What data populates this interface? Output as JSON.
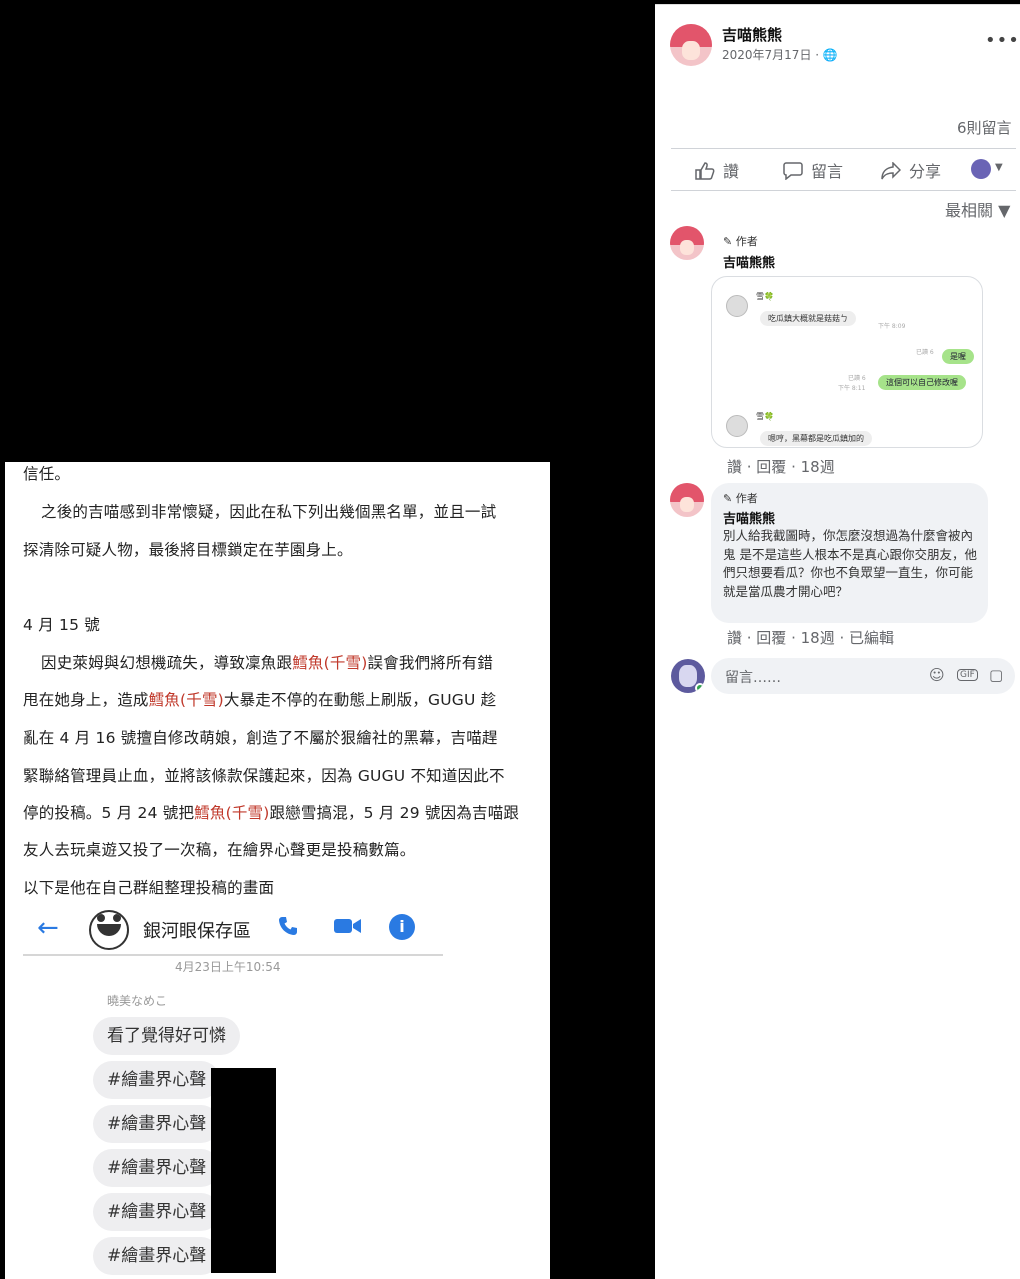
{
  "document": {
    "lines": [
      "信任。",
      "之後的吉喵感到非常懷疑，因此在私下列出幾個黑名單，並且一試",
      "探清除可疑人物，最後將目標鎖定在芋園身上。",
      "4 月 15 號",
      "因史萊姆與幻想機疏失，導致凜魚跟",
      "鱈魚(千雪)",
      "誤會我們將所有錯",
      "甩在她身上，造成",
      "鱈魚(千雪)",
      "大暴走不停的在動態上刷版，GUGU 趁",
      "亂在 4 月 16 號擅自修改萌娘，創造了不屬於狠繪社的黑幕，吉喵趕",
      "緊聯絡管理員止血，並將該條款保護起來，因為 GUGU 不知道因此不",
      "停的投稿。5 月 24 號把",
      "鱈魚(千雪)",
      "跟戀雪搞混，5 月 29 號因為吉喵跟",
      "友人去玩桌遊又投了一次稿，在繪界心聲更是投稿數篇。",
      "以下是他在自己群組整理投稿的畫面"
    ],
    "messenger": {
      "back_icon": "←",
      "group_name": "銀河眼保存區",
      "date": "4月23日上午10:54",
      "sender": "曉美なめこ",
      "messages": [
        "看了覺得好可憐",
        "#繪畫界心聲",
        "#繪畫界心聲",
        "#繪畫界心聲",
        "#繪畫界心聲",
        "#繪畫界心聲"
      ]
    }
  },
  "post": {
    "author": "吉喵熊熊",
    "date": "2020年7月17日 · 🌐",
    "more": "•••",
    "comment_count": "6則留言",
    "actions": {
      "like": "讚",
      "comment": "留言",
      "share": "分享"
    },
    "sort": "最相關 ▼",
    "comments": [
      {
        "author_tag": "✎ 作者",
        "name": "吉喵熊熊",
        "screenshot": {
          "name1": "雪🍀",
          "msg1": "吃瓜鎮大概就是菇菇ㄅ",
          "time1": "下午 8:09",
          "read1": "已讀 6",
          "msg2": "是喔",
          "read2": "已讀 6",
          "time2": "下午 8:11",
          "msg3": "這個可以自己修改喔",
          "name2": "雪🍀",
          "msg4": "嗯哼，黑幕都是吃瓜鎮加的"
        },
        "meta": "讚 · 回覆 · 18週"
      },
      {
        "author_tag": "✎ 作者",
        "name": "吉喵熊熊",
        "text": "別人給我截圖時，你怎麼沒想過為什麼會被內鬼 是不是這些人根本不是真心跟你交朋友，他們只想要看瓜？你也不負眾望一直生，你可能就是當瓜農才開心吧？",
        "meta": "讚 · 回覆 · 18週 · 已編輯"
      }
    ],
    "reply_placeholder": "留言……"
  }
}
